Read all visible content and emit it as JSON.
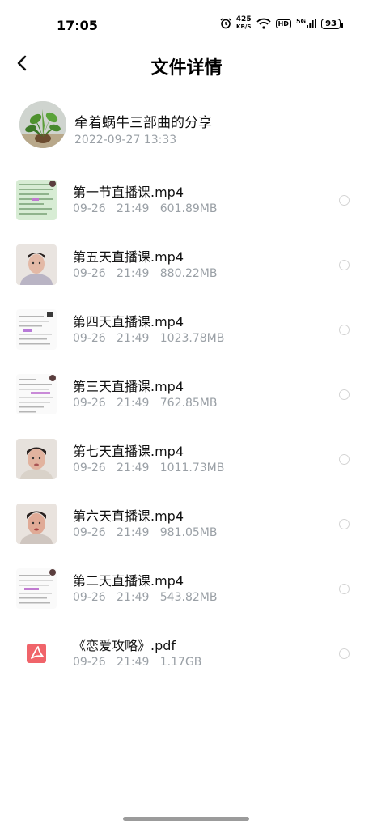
{
  "status_bar": {
    "time": "17:05",
    "net_speed_value": "425",
    "net_speed_unit": "KB/S",
    "hd": "HD",
    "signal_label": "5G",
    "battery": "93"
  },
  "header": {
    "title": "文件详情"
  },
  "sharer": {
    "name": "牵着蜗牛三部曲的分享",
    "time": "2022-09-27   13:33"
  },
  "files": [
    {
      "name": "第一节直播课.mp4",
      "date": "09-26",
      "time": "21:49",
      "size": "601.89MB"
    },
    {
      "name": "第五天直播课.mp4",
      "date": "09-26",
      "time": "21:49",
      "size": "880.22MB"
    },
    {
      "name": "第四天直播课.mp4",
      "date": "09-26",
      "time": "21:49",
      "size": "1023.78MB"
    },
    {
      "name": "第三天直播课.mp4",
      "date": "09-26",
      "time": "21:49",
      "size": "762.85MB"
    },
    {
      "name": "第七天直播课.mp4",
      "date": "09-26",
      "time": "21:49",
      "size": "1011.73MB"
    },
    {
      "name": "第六天直播课.mp4",
      "date": "09-26",
      "time": "21:49",
      "size": "981.05MB"
    },
    {
      "name": "第二天直播课.mp4",
      "date": "09-26",
      "time": "21:49",
      "size": "543.82MB"
    },
    {
      "name": "《恋爱攻略》.pdf",
      "date": "09-26",
      "time": "21:49",
      "size": "1.17GB"
    }
  ],
  "colors": {
    "pdf_icon": "#f0646a",
    "meta_text": "#9aa0a6"
  }
}
